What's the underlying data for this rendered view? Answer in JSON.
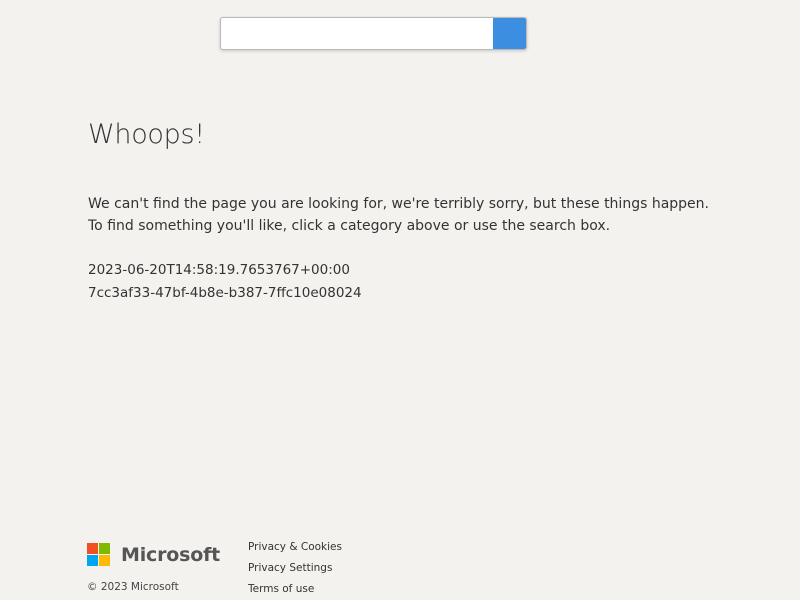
{
  "search": {
    "value": "",
    "placeholder": "",
    "button_color": "#3c8fe0"
  },
  "content": {
    "heading": "Whoops!",
    "message_lines": [
      "We can't find the page you are looking for, we're terribly sorry, but these things happen.",
      "To find something you'll like, click a category above or use the search box."
    ],
    "timestamp": "2023-06-20T14:58:19.7653767+00:00",
    "request_id": "7cc3af33-47bf-4b8e-b387-7ffc10e08024"
  },
  "footer": {
    "brand": "Microsoft",
    "logo_colors": [
      "#f25022",
      "#7fba00",
      "#00a4ef",
      "#ffb900"
    ],
    "copyright": "© 2023 Microsoft",
    "links": [
      "Privacy & Cookies",
      "Privacy Settings",
      "Terms of use"
    ]
  }
}
